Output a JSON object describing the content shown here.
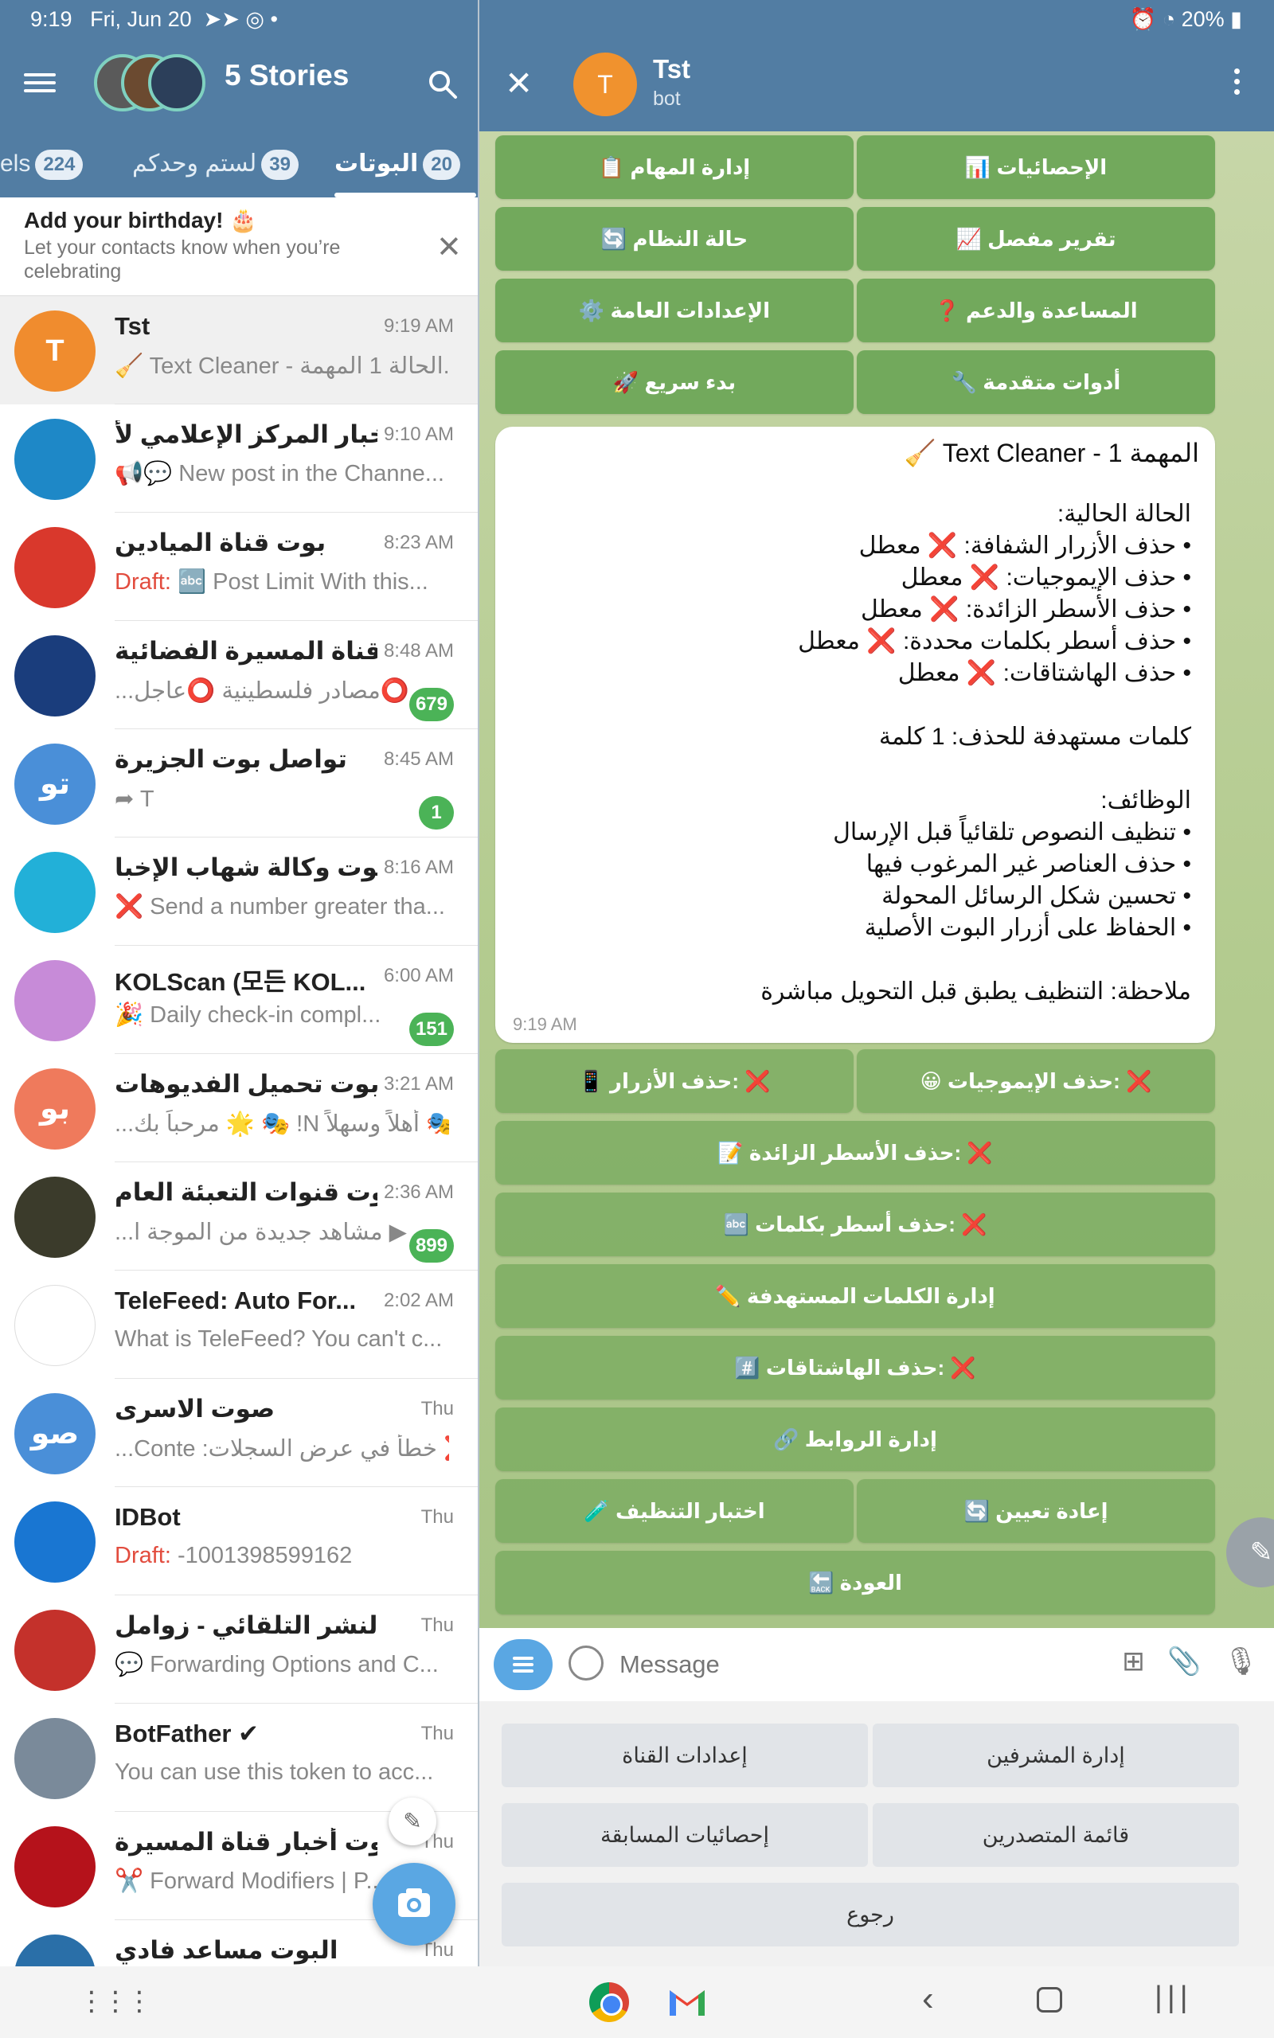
{
  "status_bar": {
    "time": "9:19",
    "date": "Fri, Jun 20",
    "battery": "20%"
  },
  "left_header": {
    "stories_title": "5 Stories"
  },
  "tabs": [
    {
      "label": "els",
      "count": "224"
    },
    {
      "label": "لستم وحدكم",
      "count": "39"
    },
    {
      "label": "البوتات",
      "count": "20"
    }
  ],
  "birthday": {
    "title": "Add your birthday! 🎂",
    "text": "Let your contacts know when you’re celebrating"
  },
  "chats": [
    {
      "name": "Tst",
      "time": "9:19 AM",
      "preview": "🧹 Text Cleaner - الحالة  1 المهمة...",
      "avatar": "T",
      "color": "#f08c2e"
    },
    {
      "name": "أخبار المركز الإعلامي لأ...",
      "time": "9:10 AM",
      "preview": "📢💬 New post in the Channe...",
      "avatar": "",
      "color": "#1e88c7"
    },
    {
      "name": "بوت قناة الميادين",
      "time": "8:23 AM",
      "draft": "Draft:",
      "preview": " 🔤 Post Limit   With this...",
      "avatar": "",
      "color": "#d9382c"
    },
    {
      "name": "قناة المسيرة الفضائية",
      "time": "8:48 AM",
      "preview": "...مصادر فلسطينية ⭕عاجل⭕",
      "badge": "679",
      "avatar": "",
      "color": "#1a3d7c"
    },
    {
      "name": "تواصل بوت الجزيرة",
      "time": "8:45 AM",
      "preview": "➦ T",
      "badge": "1",
      "avatar": "تو",
      "color": "#4a8fd8"
    },
    {
      "name": "بوت وكالة شهاب الإخبا...",
      "time": "8:16 AM",
      "preview": "❌ Send a number greater tha...",
      "avatar": "",
      "color": "#22b0d8"
    },
    {
      "name": "KOLScan (모든 KOL...",
      "time": "6:00 AM",
      "preview": "🎉 Daily check-in compl...",
      "badge": "151",
      "avatar": "",
      "color": "#c78bd8"
    },
    {
      "name": "بوت تحميل الفديوهات...",
      "time": "3:21 AM",
      "preview": "...مرحباً بك 🌟 🎭 !N أهلاً وسهلاً 🎭",
      "avatar": "بو",
      "color": "#ef7a5c"
    },
    {
      "name": "بوت قنوات التعبئة العام...",
      "time": "2:36 AM",
      "preview": "...مشاهد جديدة من الموجة ا ▶",
      "badge": "899",
      "avatar": "",
      "color": "#3b3b2b"
    },
    {
      "name": "TeleFeed: Auto For...",
      "time": "2:02 AM",
      "preview": "What is TeleFeed? You can't c...",
      "avatar": "",
      "color": "#ffffff"
    },
    {
      "name": "صوت الاسرى",
      "time": "Thu",
      "preview": "...Conte :خطأ في عرض السجلات ❌",
      "avatar": "صو",
      "color": "#4a8fd8"
    },
    {
      "name": "IDBot",
      "time": "Thu",
      "draft": "Draft:",
      "preview": " -1001398599162",
      "avatar": "",
      "color": "#1976d2"
    },
    {
      "name": "النشر التلقائي - زوامل",
      "time": "Thu",
      "preview": "💬 Forwarding Options and C...",
      "avatar": "",
      "color": "#c4312b"
    },
    {
      "name": "BotFather ✔",
      "time": "Thu",
      "preview": "You can use this token to acc...",
      "avatar": "",
      "color": "#7a8a9a"
    },
    {
      "name": "بوت أخبار قناة المسيرة",
      "time": "Thu",
      "preview": "✂️ Forward Modifiers | P...",
      "avatar": "",
      "color": "#b5121b"
    },
    {
      "name": "البوت مساعد فادي",
      "time": "Thu",
      "preview": "",
      "avatar": "",
      "color": "#2a6fa8"
    }
  ],
  "right_header": {
    "title": "Tst",
    "subtitle": "bot",
    "avatar": "T"
  },
  "top_keyboard": [
    "📊 الإحصائيات",
    "📋 إدارة المهام",
    "📈 تقرير مفصل",
    "🔄 حالة النظام",
    "❓ المساعدة والدعم",
    "⚙️ الإعدادات العامة",
    "🔧 أدوات متقدمة",
    "🚀 بدء سريع"
  ],
  "message": {
    "title": "🧹 Text Cleaner - 1 المهمة",
    "body": "الحالة الحالية:\n• حذف الأزرار الشفافة: ❌ معطل\n• حذف الإيموجيات: ❌ معطل\n• حذف الأسطر الزائدة: ❌ معطل\n• حذف أسطر بكلمات محددة: ❌ معطل\n• حذف الهاشتاقات: ❌ معطل\n\nكلمات مستهدفة للحذف: 1 كلمة\n\nالوظائف:\n• تنظيف النصوص تلقائياً قبل الإرسال\n• حذف العناصر غير المرغوب فيها\n• تحسين شكل الرسائل المحولة\n• الحفاظ على أزرار البوت الأصلية\n\nملاحظة: التنظيف يطبق قبل التحويل مباشرة",
    "time": "9:19 AM"
  },
  "inline_keyboard": [
    "😀 حذف الإيموجيات: ❌",
    "📱 حذف الأزرار: ❌",
    "📝 حذف الأسطر الزائدة: ❌",
    "🔤 حذف أسطر بكلمات: ❌",
    "✏️ إدارة الكلمات المستهدفة",
    "#️⃣ حذف الهاشتاقات: ❌",
    "🔗 إدارة الروابط",
    "🔄 إعادة تعيين",
    "🧪 اختبار التنظيف",
    "🔙 العودة"
  ],
  "input": {
    "placeholder": "Message"
  },
  "bot_keyboard": [
    "إدارة المشرفين",
    "إعدادات القناة",
    "قائمة المتصدرين",
    "إحصائيات المسابقة",
    "رجوع"
  ]
}
